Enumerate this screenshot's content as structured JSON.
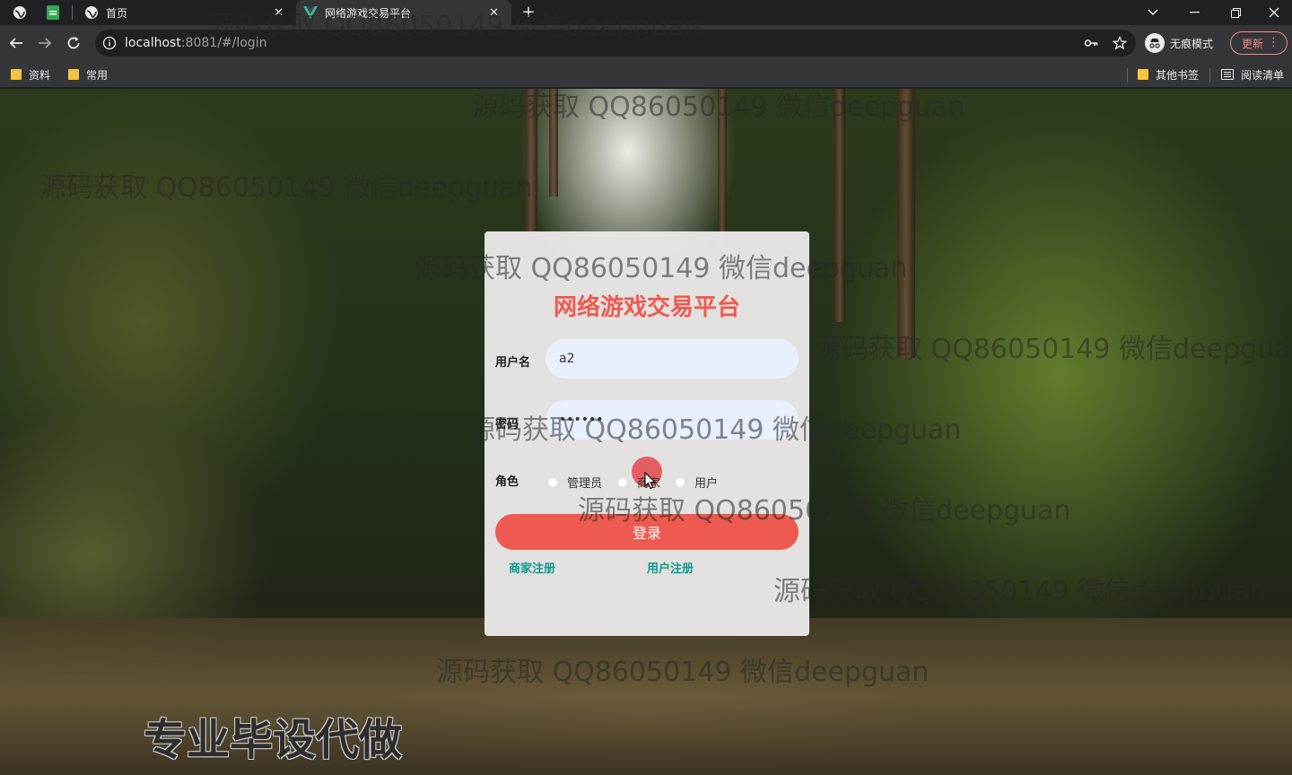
{
  "browser": {
    "tabs": [
      {
        "title": ""
      },
      {
        "title": "首页"
      },
      {
        "title": "网络游戏交易平台"
      }
    ],
    "url_host": "localhost",
    "url_rest": ":8081/#/login",
    "incognito_label": "无痕模式",
    "update_label": "更新",
    "bookmarks": [
      "资料",
      "常用"
    ],
    "other_bookmarks": "其他书签",
    "reading_list": "阅读清单"
  },
  "login": {
    "title": "网络游戏交易平台",
    "username_label": "用户名",
    "username_value": "a2",
    "password_label": "密码",
    "password_value": "••••••",
    "role_label": "角色",
    "roles": [
      "管理员",
      "商家",
      "用户"
    ],
    "login_button": "登录",
    "merchant_register": "商家注册",
    "user_register": "用户注册"
  },
  "overlay": {
    "watermark_text": "源码获取 QQ86050149 微信deepguan",
    "promo_text": "专业毕设代做"
  },
  "colors": {
    "accent": "#ee5a4f",
    "link": "#0f9b8e",
    "input_bg": "#e8f0fe"
  }
}
